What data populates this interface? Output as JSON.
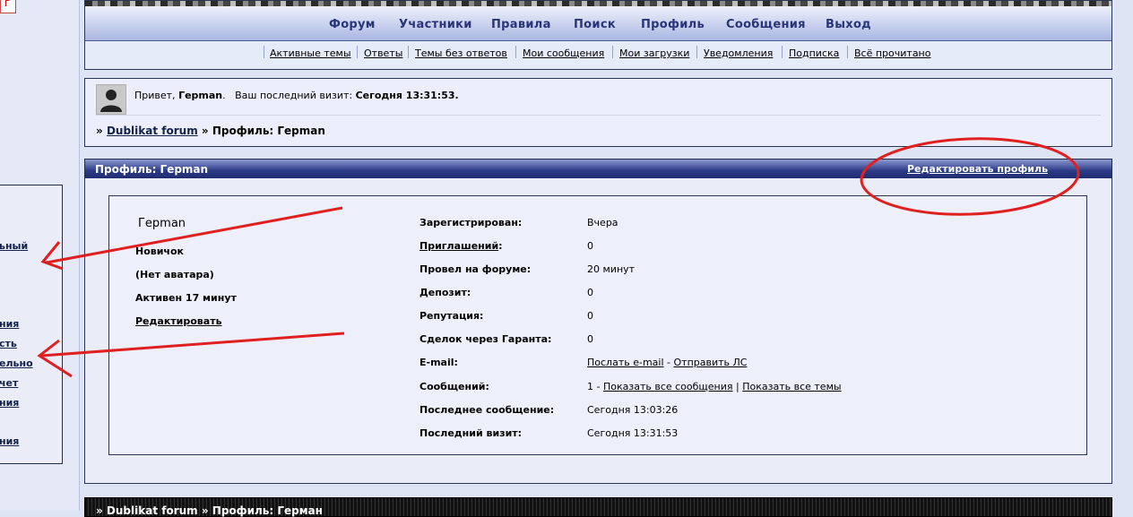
{
  "sidebar": {
    "mark_letter": "Г",
    "links": [
      "ьный",
      "ния",
      "сть",
      "ельно",
      "чет",
      "ния",
      "ния"
    ]
  },
  "nav": {
    "main": [
      "Форум",
      "Участники",
      "Правила",
      "Поиск",
      "Профиль",
      "Сообщения",
      "Выход"
    ],
    "sub": [
      "Активные темы",
      "Ответы",
      "Темы без ответов",
      "Мои сообщения",
      "Мои загрузки",
      "Уведомления",
      "Подписка",
      "Всё прочитано"
    ]
  },
  "welcome": {
    "greeting_prefix": "Привет,",
    "username": "Герman",
    "last_visit_label": "Ваш последний визит:",
    "last_visit_value": "Сегодня 13:31:53."
  },
  "breadcrumb": {
    "sep": "»",
    "forum": "Dublikat forum",
    "sep2": "»",
    "current": "Профиль: Герman"
  },
  "profile": {
    "header_title": "Профиль: Герman",
    "edit_link": "Редактировать профиль",
    "name": "Герman",
    "rank": "Новичок",
    "avatar": "(Нет аватара)",
    "active": "Активен 17 минут",
    "edit": "Редактировать",
    "fields": {
      "registered_label": "Зарегистрирован:",
      "registered_value": "Вчера",
      "invites_label": "Приглашений",
      "invites_colon": ":",
      "invites_value": "0",
      "time_label": "Провел на форуме:",
      "time_value": "20 минут",
      "deposit_label": "Депозит:",
      "deposit_value": "0",
      "rep_label": "Репутация:",
      "rep_value": "0",
      "guarant_label": "Сделок через Гаранта:",
      "guarant_value": "0",
      "email_label": "E-mail:",
      "email_send": "Послать e-mail",
      "email_dash": "-",
      "email_pm": "Отправить ЛС",
      "posts_label": "Сообщений:",
      "posts_count": "1 -",
      "posts_all": "Показать все сообщения",
      "posts_sep": "|",
      "posts_topics": "Показать все темы",
      "last_post_label": "Последнее сообщение:",
      "last_post_value": "Сегодня 13:03:26",
      "last_visit_label": "Последний визит:",
      "last_visit_value": "Сегодня 13:31:53"
    }
  },
  "bottom": {
    "text": "» Dublikat forum » Профиль: Герман"
  },
  "colors": {
    "header_blue": "#2b3a86",
    "annotation_red": "#e02020"
  }
}
